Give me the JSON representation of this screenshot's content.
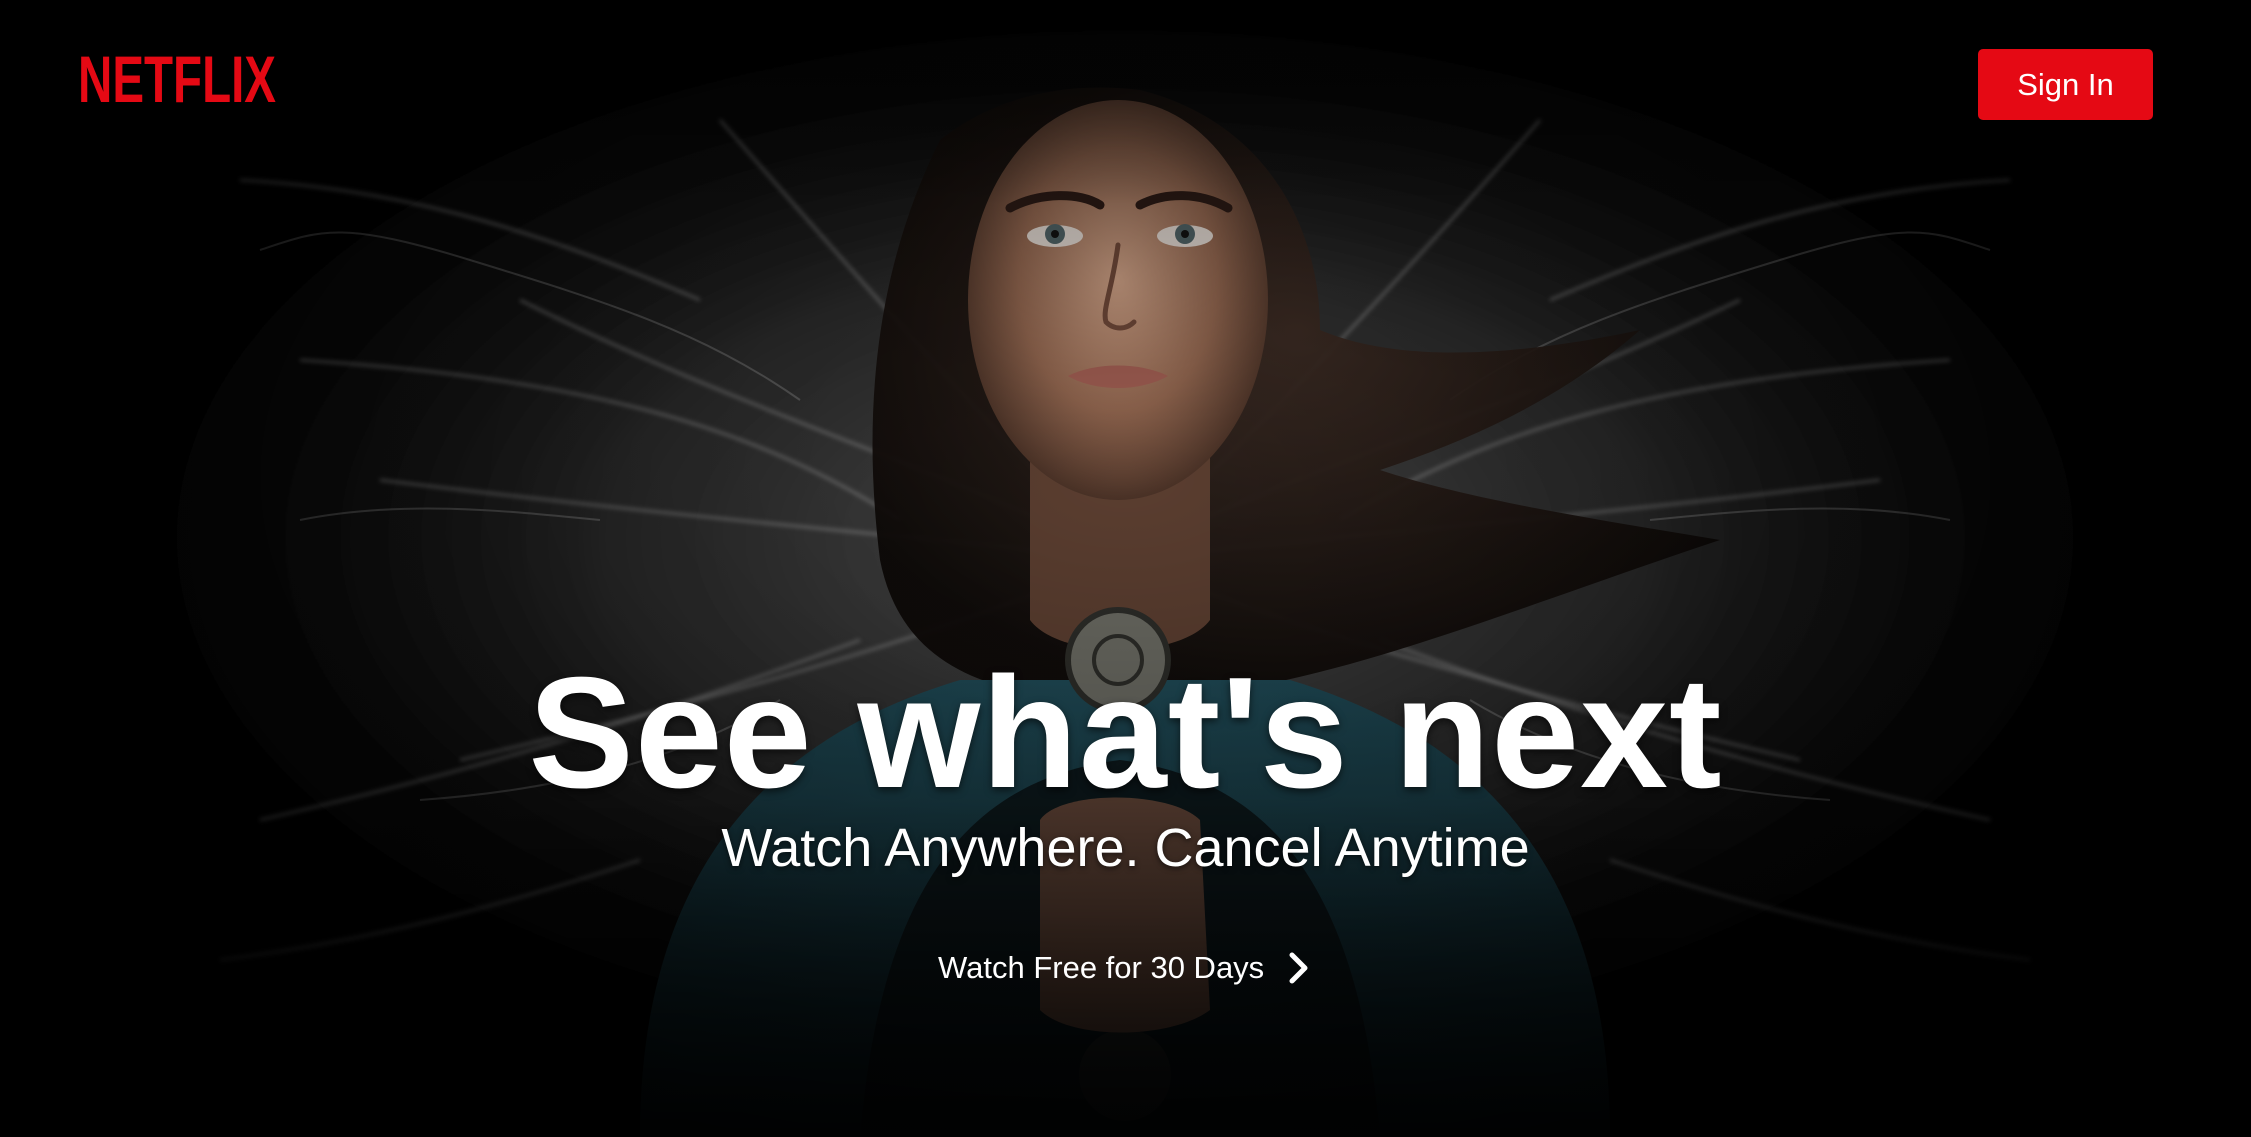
{
  "brand": {
    "logo_text": "NETFLIX",
    "logo_color": "#e50914"
  },
  "header": {
    "sign_in_label": "Sign In",
    "sign_in_color": "#e50914"
  },
  "hero": {
    "headline": "See what's next",
    "subheadline": "Watch Anywhere. Cancel Anytime",
    "cta_label": "Watch Free for 30 Days",
    "cta_icon": "chevron-right-icon",
    "background_art": "portrait of a woman surrounded by white wispy tendrils on black"
  }
}
